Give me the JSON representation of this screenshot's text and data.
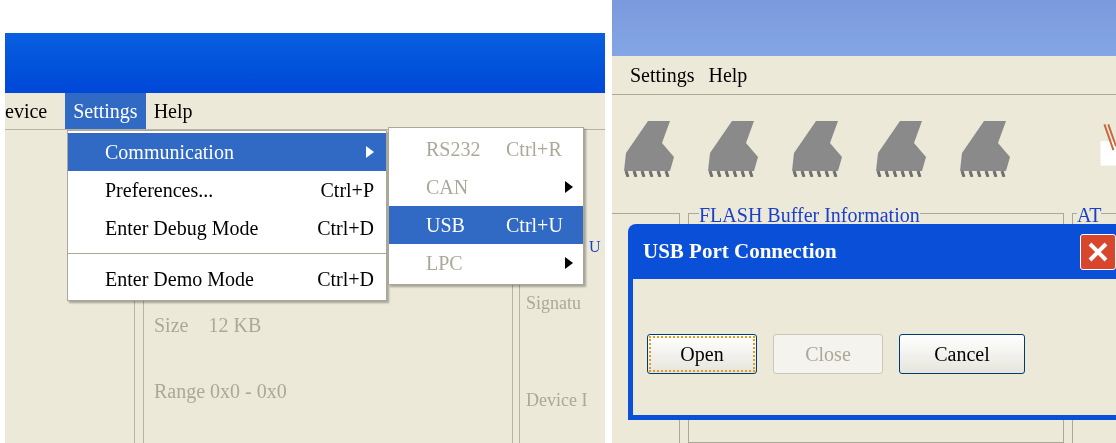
{
  "left": {
    "menu_bar": [
      {
        "label": "evice",
        "selected": false
      },
      {
        "label": "Settings",
        "selected": true
      },
      {
        "label": "Help",
        "selected": false
      }
    ],
    "menu": [
      {
        "kind": "item",
        "label": "Communication",
        "submenu": true,
        "selected": true
      },
      {
        "kind": "item",
        "label": "Preferences...",
        "shortcut": "Ctrl+P",
        "submenu": false,
        "selected": false
      },
      {
        "kind": "item",
        "label": "Enter Debug Mode",
        "shortcut": "Ctrl+D",
        "submenu": false,
        "selected": false
      },
      {
        "kind": "separator"
      },
      {
        "kind": "item",
        "label": "Enter Demo Mode",
        "shortcut": "Ctrl+D",
        "submenu": false,
        "selected": false
      }
    ],
    "submenu": [
      {
        "label": "RS232",
        "shortcut": "Ctrl+R",
        "submenu": false,
        "selected": false,
        "disabled": true
      },
      {
        "label": "CAN",
        "submenu": true,
        "selected": false,
        "disabled": true
      },
      {
        "label": "USB",
        "shortcut": "Ctrl+U",
        "submenu": false,
        "selected": true,
        "disabled": false
      },
      {
        "label": "LPC",
        "submenu": true,
        "selected": false,
        "disabled": true
      }
    ],
    "panel": {
      "size_label": "Size",
      "size_value": "12 KB",
      "range": "Range 0x0 - 0x0"
    },
    "side": {
      "heading": "U",
      "signature": "Signatu",
      "device": "Device I"
    }
  },
  "right": {
    "menu_bar": [
      {
        "label": "Settings"
      },
      {
        "label": "Help"
      }
    ],
    "groups": [
      {
        "title": "FLASH Buffer Information"
      },
      {
        "title": "AT"
      }
    ],
    "dialog": {
      "title": "USB Port Connection",
      "buttons": [
        {
          "label": "Open",
          "focused": true,
          "disabled": false
        },
        {
          "label": "Close",
          "focused": false,
          "disabled": true
        },
        {
          "label": "Cancel",
          "focused": false,
          "disabled": false
        }
      ]
    }
  }
}
